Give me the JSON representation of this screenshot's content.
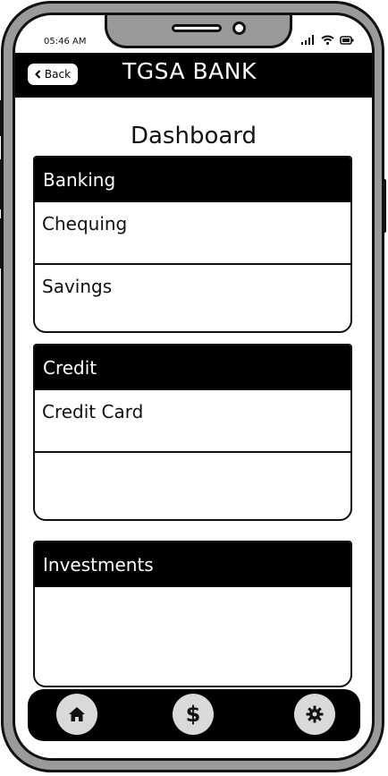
{
  "status": {
    "time": "05:46 AM"
  },
  "header": {
    "back_label": "Back",
    "title": "TGSA BANK"
  },
  "page": {
    "title": "Dashboard"
  },
  "sections": [
    {
      "title": "Banking",
      "items": [
        "Chequing",
        "Savings"
      ]
    },
    {
      "title": "Credit",
      "items": [
        "Credit Card",
        ""
      ]
    },
    {
      "title": "Investments",
      "items": []
    }
  ],
  "bottom_nav": [
    {
      "icon": "home-icon"
    },
    {
      "icon": "dollar-icon",
      "glyph": "$"
    },
    {
      "icon": "gear-icon"
    }
  ]
}
